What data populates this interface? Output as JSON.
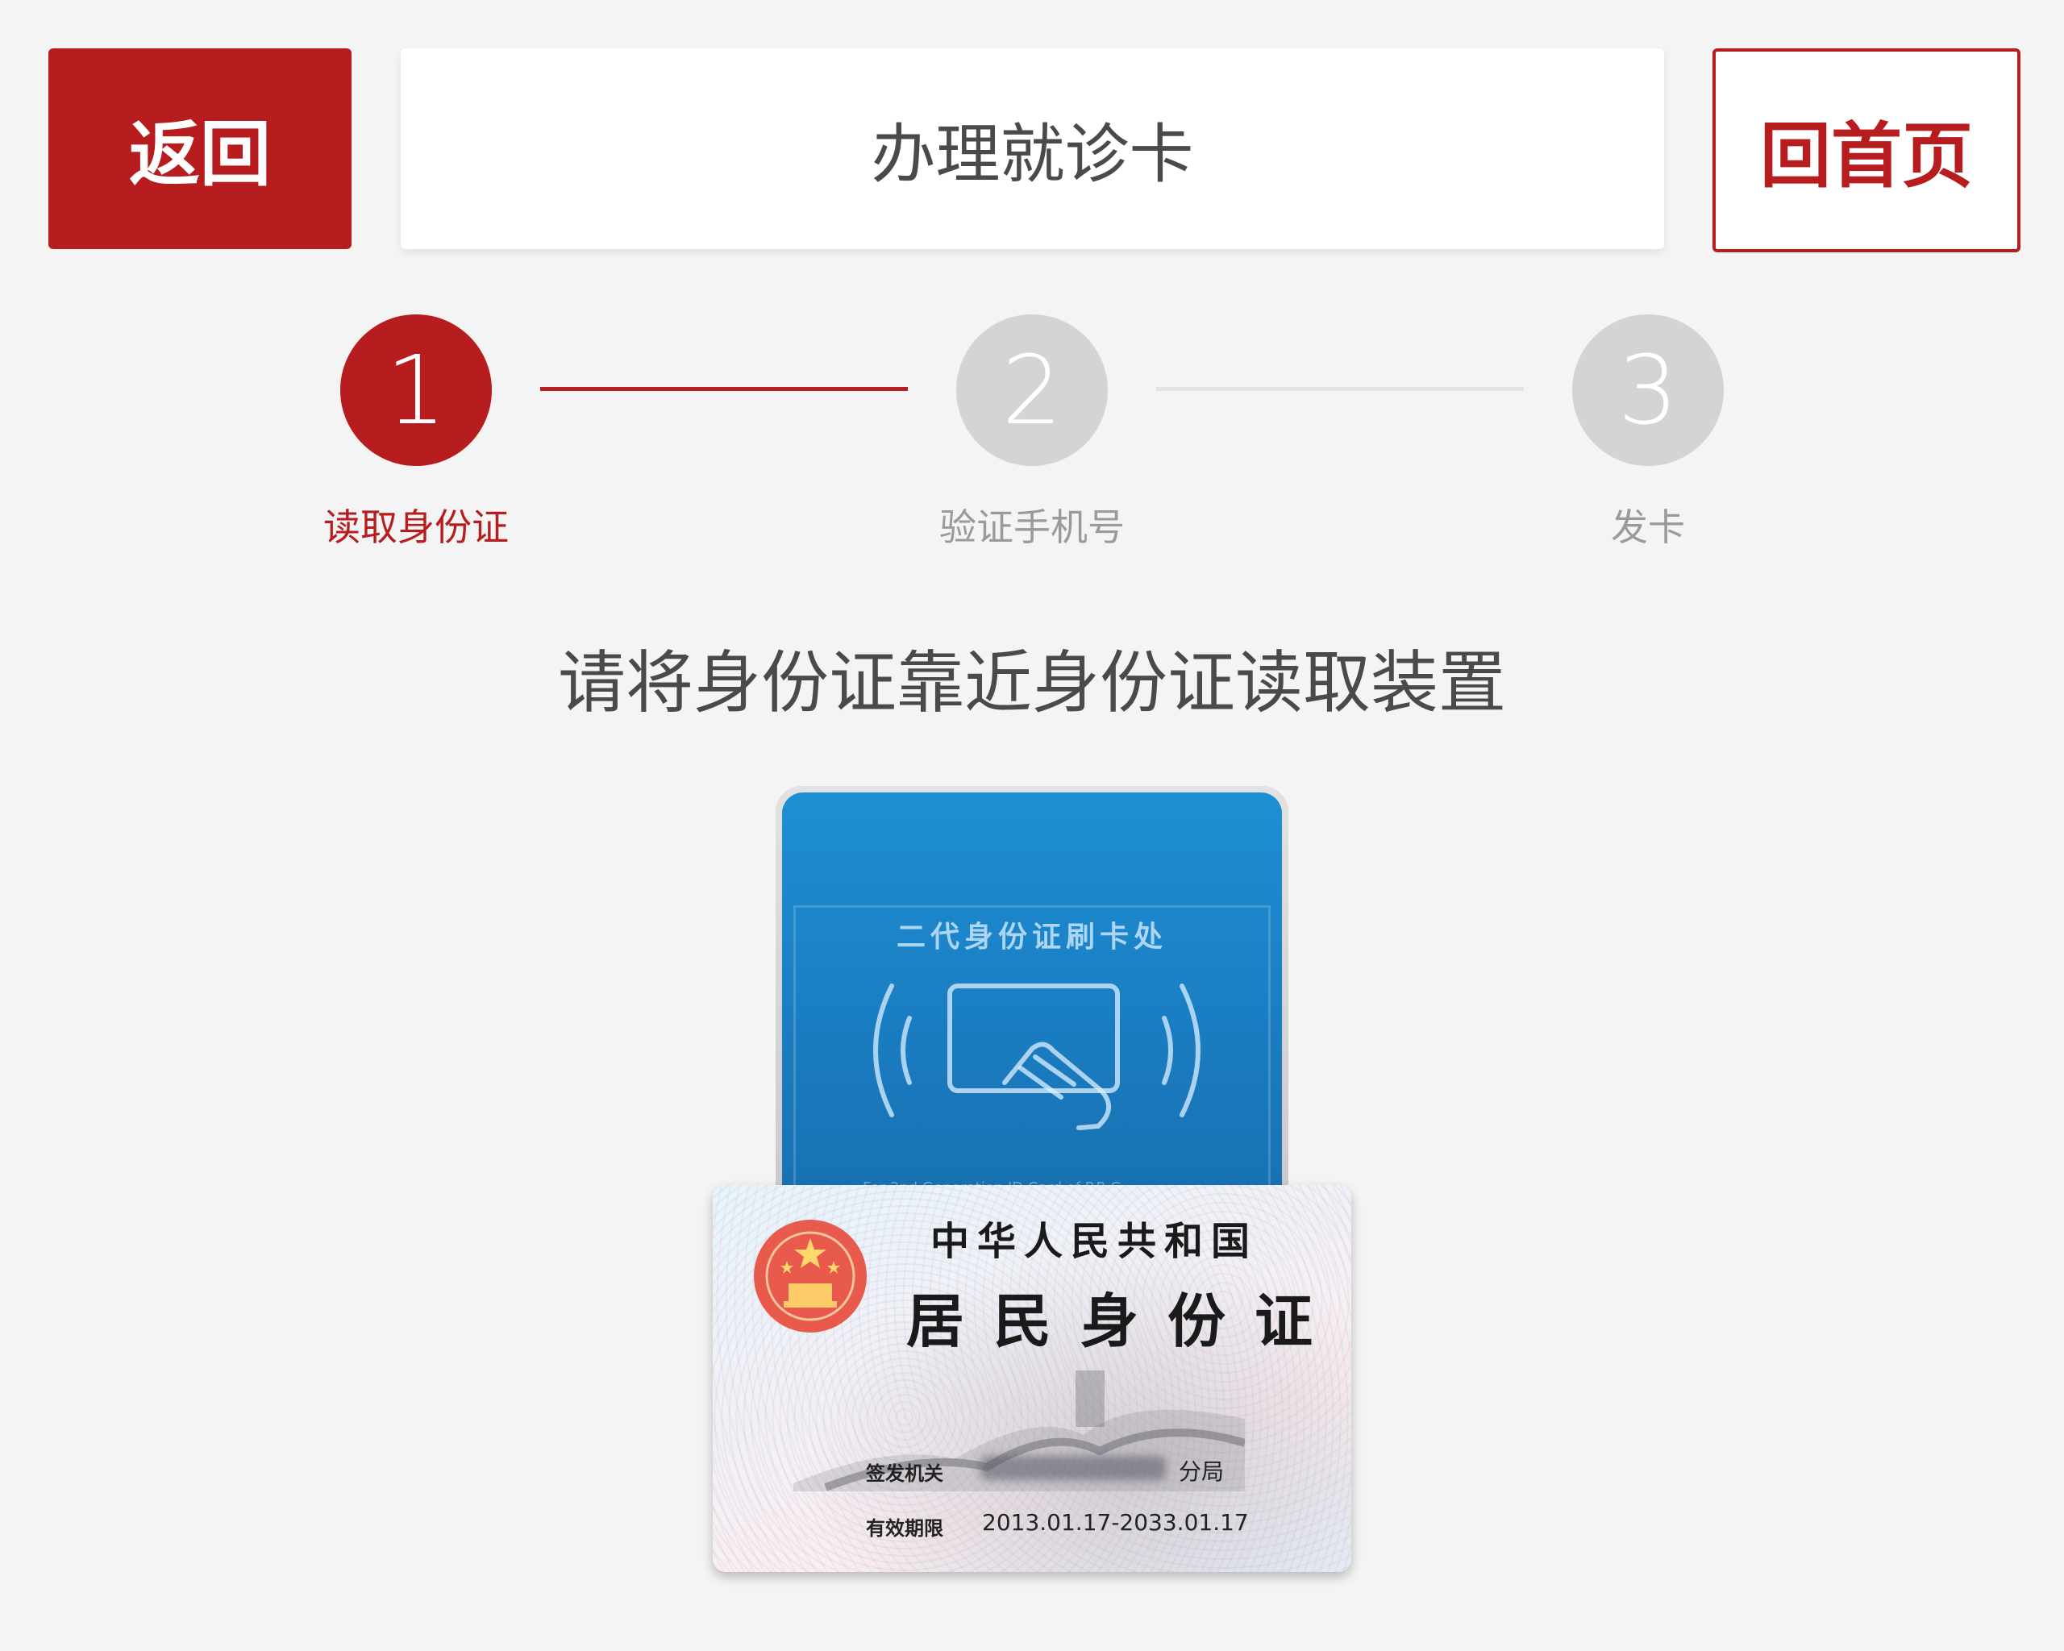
{
  "header": {
    "back_label": "返回",
    "title": "办理就诊卡",
    "home_label": "回首页"
  },
  "steps": [
    {
      "number": "1",
      "label": "读取身份证",
      "state": "active"
    },
    {
      "number": "2",
      "label": "验证手机号",
      "state": "inactive"
    },
    {
      "number": "3",
      "label": "发卡",
      "state": "inactive"
    }
  ],
  "instruction": "请将身份证靠近身份证读取装置",
  "illustration": {
    "reader_label": "二代身份证刷卡处",
    "reader_sub": "For 2nd Generation ID Card of P.R.C",
    "card_country": "中华人民共和国",
    "card_type": "居民身份证",
    "authority_label": "签发机关",
    "authority_suffix": "分局",
    "validity_label": "有效期限",
    "validity_value": "2013.01.17-2033.01.17"
  },
  "colors": {
    "accent": "#b71c1e",
    "inactive": "#d4d4d4",
    "background": "#f4f4f4"
  }
}
